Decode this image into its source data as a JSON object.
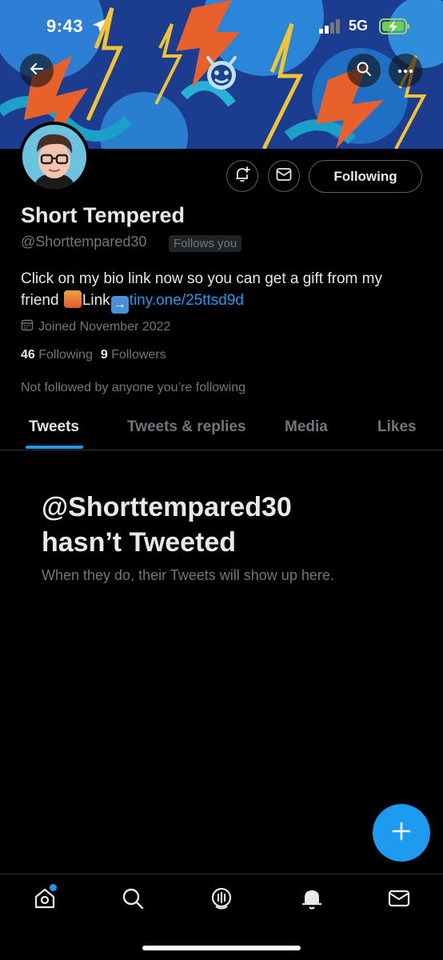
{
  "status_bar": {
    "time": "9:43",
    "network": "5G"
  },
  "profile": {
    "name": "Short Tempered",
    "handle": "@Shorttempared30",
    "follows_you": "Follows you",
    "bio_text": "Click on my bio link now so you can get a gift from my friend ",
    "bio_link_word": "Link",
    "bio_url": "tiny.one/25ttsd9d",
    "joined": "Joined November 2022",
    "following_count": "46",
    "following_label": "Following",
    "followers_count": "9",
    "followers_label": "Followers",
    "not_followed_text": "Not followed by anyone you’re following"
  },
  "actions": {
    "following_button": "Following"
  },
  "tabs": [
    {
      "label": "Tweets",
      "active": true
    },
    {
      "label": "Tweets & replies",
      "active": false
    },
    {
      "label": "Media",
      "active": false
    },
    {
      "label": "Likes",
      "active": false
    }
  ],
  "empty_state": {
    "title_line1": "@Shorttempared30",
    "title_line2": "hasn’t Tweeted",
    "subtitle": "When they do, their Tweets will show up here."
  },
  "bottom_nav": [
    "home-icon",
    "search-icon",
    "spaces-icon",
    "notifications-icon",
    "messages-icon"
  ],
  "colors": {
    "accent": "#1d9bf0",
    "background": "#000000",
    "muted": "#71767b",
    "text": "#e7e9ea"
  }
}
